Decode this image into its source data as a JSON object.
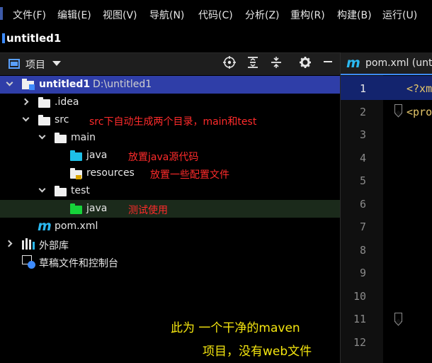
{
  "menu": {
    "items": [
      "文件(F)",
      "编辑(E)",
      "视图(V)",
      "导航(N)",
      "代码(C)",
      "分析(Z)",
      "重构(R)",
      "构建(B)",
      "运行(U)"
    ]
  },
  "project_title": "untitled1",
  "tool_window": {
    "title": "项目",
    "toolbar_icons": [
      "locate-icon",
      "expand-all-icon",
      "collapse-all-icon",
      "gear-icon",
      "minimize-icon"
    ]
  },
  "tree": {
    "root": {
      "name": "untitled1",
      "path": "D:\\untitled1"
    },
    "idea": ".idea",
    "src": {
      "name": "src",
      "note": "src下自动生成两个目录，main和test"
    },
    "main": "main",
    "main_java": {
      "name": "java",
      "note": "放置java源代码"
    },
    "resources": {
      "name": "resources",
      "note": "放置一些配置文件"
    },
    "test": "test",
    "test_java": {
      "name": "java",
      "note": "测试使用"
    },
    "pom": "pom.xml",
    "external_libs": "外部库",
    "scratches": "草稿文件和控制台"
  },
  "note": {
    "line1": "此为 一个干净的maven",
    "line2": "项目，没有web文件"
  },
  "editor": {
    "tab_label": "pom.xml (unt",
    "line_numbers": [
      "1",
      "2",
      "3",
      "4",
      "5",
      "6",
      "7",
      "8",
      "9",
      "10",
      "11",
      "12"
    ],
    "code_lines": [
      "<?xm",
      "<pro"
    ]
  },
  "colors": {
    "selection": "#2f3ea8",
    "annotation": "#ff2b2b",
    "note": "#f5e60f",
    "source_folder": "#1ec0e8",
    "test_folder": "#16d43a",
    "maven_icon": "#2bb8f0"
  }
}
